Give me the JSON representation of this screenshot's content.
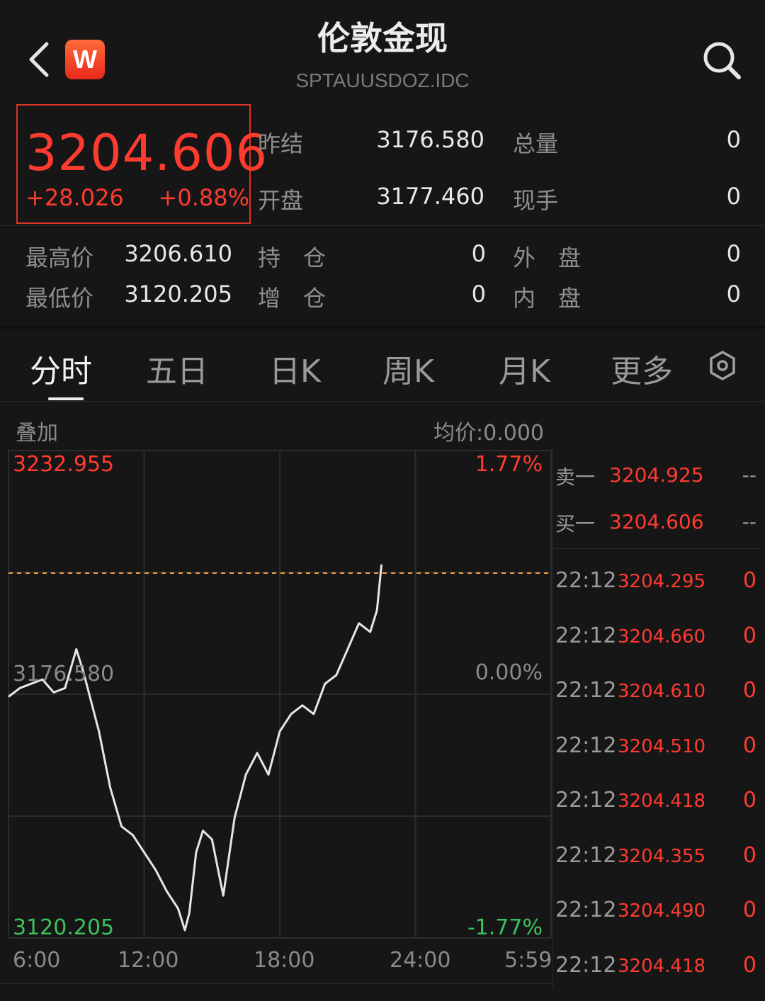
{
  "header": {
    "title": "伦敦金现",
    "symbol": "SPTAUUSDOZ.IDC",
    "logo_text": "W",
    "back_icon": "chevron-left-icon",
    "search_icon": "search-icon"
  },
  "quote": {
    "last_price": "3204.606",
    "change": "+28.026",
    "change_pct": "+0.88%",
    "stats": [
      {
        "label": "昨结",
        "value": "3176.580"
      },
      {
        "label": "开盘",
        "value": "3177.460"
      },
      {
        "label": "总量",
        "value": "0"
      },
      {
        "label": "现手",
        "value": "0"
      },
      {
        "label": "最高价",
        "value": "3206.610"
      },
      {
        "label": "最低价",
        "value": "3120.205"
      },
      {
        "label": "持　仓",
        "value": "0"
      },
      {
        "label": "增　仓",
        "value": "0"
      },
      {
        "label": "外　盘",
        "value": "0"
      },
      {
        "label": "内　盘",
        "value": "0"
      }
    ]
  },
  "tabs": [
    "分时",
    "五日",
    "日K",
    "周K",
    "月K",
    "更多"
  ],
  "active_tab": "分时",
  "settings_icon": "settings-icon",
  "chart_header": {
    "overlay_label": "叠加",
    "avg_price": "均价:0.000"
  },
  "chart_data": {
    "type": "line",
    "title": "",
    "y_labels": {
      "top": "3232.955",
      "middle": "3176.580",
      "bottom": "3120.205"
    },
    "pct_labels": {
      "top": "1.77%",
      "middle": "0.00%",
      "bottom": "-1.77%"
    },
    "ylim": [
      3120.205,
      3232.955
    ],
    "reference_price": 3176.58,
    "current_price": 3204.606,
    "x_ticks": [
      "6:00",
      "12:00",
      "18:00",
      "24:00",
      "5:59"
    ],
    "xlim_hours": [
      6,
      30
    ],
    "series": [
      {
        "x": [
          6.0,
          6.5,
          7.0,
          7.5,
          8.0,
          8.5,
          9.0,
          9.3,
          9.6,
          10.0,
          10.5,
          11.0,
          11.5,
          12.0,
          12.5,
          13.0,
          13.5,
          13.8,
          14.0,
          14.3,
          14.6,
          15.0,
          15.5,
          16.0,
          16.5,
          17.0,
          17.5,
          18.0,
          18.5,
          19.0,
          19.5,
          20.0,
          20.5,
          21.0,
          21.5,
          22.0,
          22.3,
          22.5
        ],
        "y": [
          3176,
          3178,
          3179,
          3180,
          3177,
          3178,
          3187,
          3182,
          3176,
          3168,
          3155,
          3146,
          3144,
          3140,
          3136,
          3131,
          3127,
          3122,
          3126,
          3140,
          3145,
          3143,
          3130,
          3148,
          3158,
          3163,
          3158,
          3168,
          3172,
          3174,
          3172,
          3179,
          3181,
          3187,
          3193,
          3191,
          3196,
          3206.6
        ]
      }
    ],
    "grid": true
  },
  "order_book": [
    {
      "label": "卖一",
      "price": "3204.925",
      "vol": "--"
    },
    {
      "label": "买一",
      "price": "3204.606",
      "vol": "--"
    }
  ],
  "ticks": [
    {
      "time": "22:12",
      "price": "3204.295",
      "vol": "0"
    },
    {
      "time": "22:12",
      "price": "3204.660",
      "vol": "0"
    },
    {
      "time": "22:12",
      "price": "3204.610",
      "vol": "0"
    },
    {
      "time": "22:12",
      "price": "3204.510",
      "vol": "0"
    },
    {
      "time": "22:12",
      "price": "3204.418",
      "vol": "0"
    },
    {
      "time": "22:12",
      "price": "3204.355",
      "vol": "0"
    },
    {
      "time": "22:12",
      "price": "3204.490",
      "vol": "0"
    },
    {
      "time": "22:12",
      "price": "3204.418",
      "vol": "0"
    }
  ]
}
